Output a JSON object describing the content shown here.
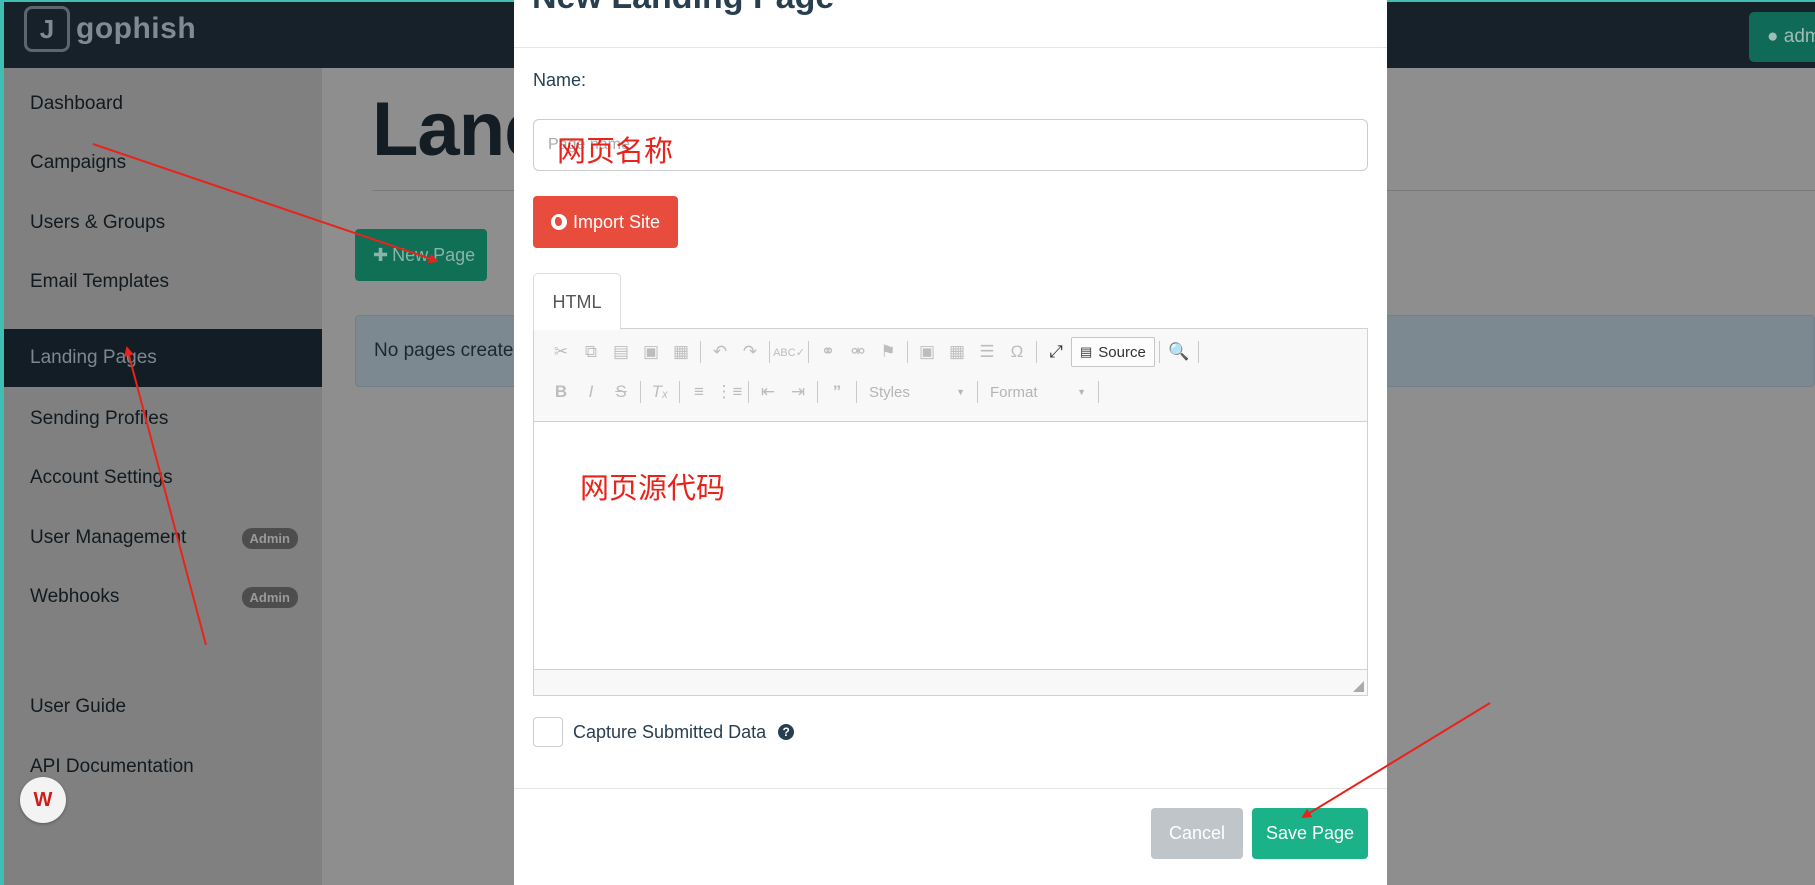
{
  "app": {
    "brand": "gophish",
    "user_button_label": "adm"
  },
  "sidebar": {
    "items": [
      {
        "label": "Dashboard"
      },
      {
        "label": "Campaigns"
      },
      {
        "label": "Users & Groups"
      },
      {
        "label": "Email Templates"
      },
      {
        "label": "Landing Pages",
        "active": true
      },
      {
        "label": "Sending Profiles"
      },
      {
        "label": "Account Settings"
      },
      {
        "label": "User Management",
        "badge": "Admin"
      },
      {
        "label": "Webhooks",
        "badge": "Admin"
      },
      {
        "label": "User Guide"
      },
      {
        "label": "API Documentation"
      }
    ]
  },
  "main": {
    "title": "Land",
    "new_page_label": "New Page",
    "alert_text": "No pages created"
  },
  "modal": {
    "title": "New Landing Page",
    "name_label": "Name:",
    "name_placeholder": "Page name",
    "import_label": "Import Site",
    "tab_html": "HTML",
    "toolbar": {
      "source_label": "Source",
      "styles_label": "Styles",
      "format_label": "Format"
    },
    "capture_label": "Capture Submitted Data",
    "cancel_label": "Cancel",
    "save_label": "Save Page"
  },
  "annotations": {
    "name_note": "网页名称",
    "source_note": "网页源代码",
    "color": "#e8231b"
  },
  "colors": {
    "navbar": "#16212a",
    "accent_teal": "#3fbfb2",
    "import_red": "#e74c3c",
    "save_green": "#1bb28a",
    "cancel_gray": "#c0c5c9"
  }
}
